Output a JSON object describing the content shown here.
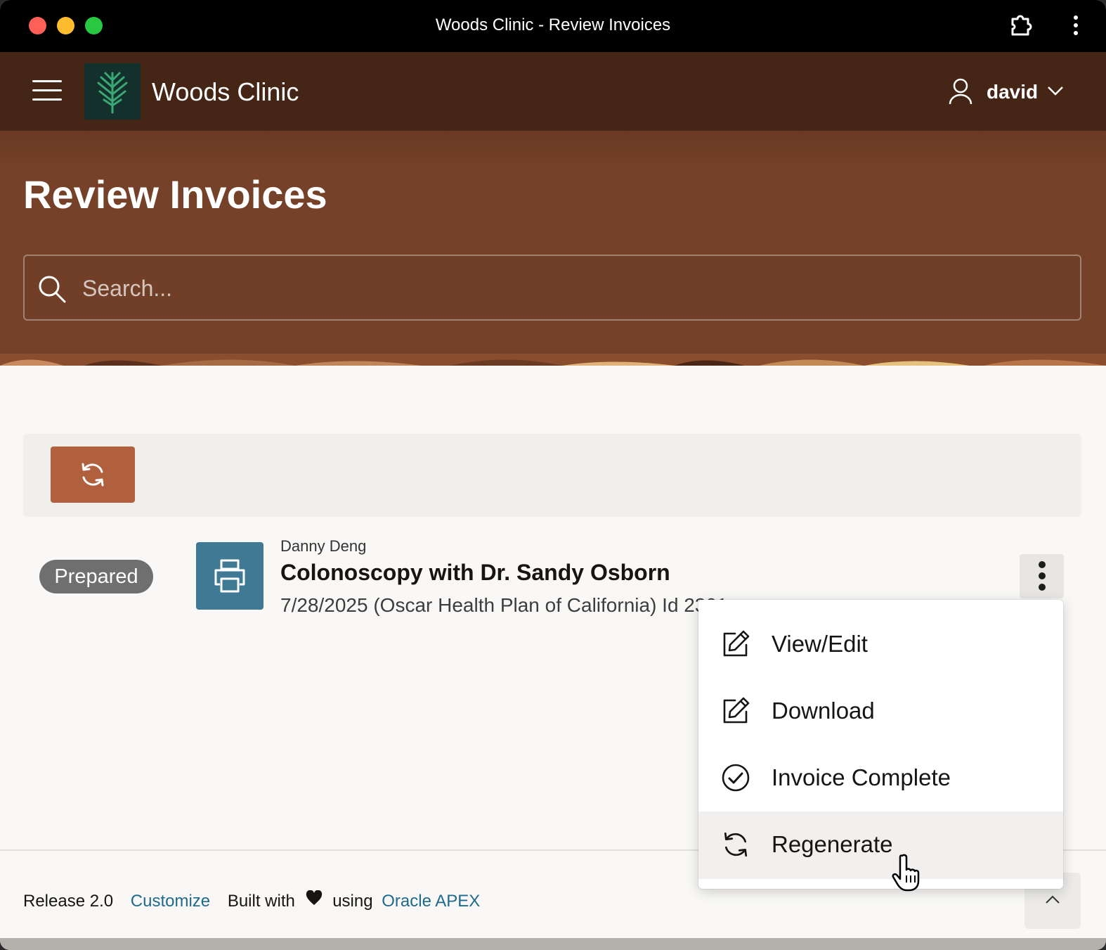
{
  "window": {
    "title": "Woods Clinic - Review Invoices"
  },
  "header": {
    "app_name": "Woods Clinic",
    "user": "david"
  },
  "page": {
    "title": "Review Invoices"
  },
  "search": {
    "placeholder": "Search..."
  },
  "invoice": {
    "status": "Prepared",
    "patient": "Danny Deng",
    "title": "Colonoscopy with Dr. Sandy Osborn",
    "detail": "7/28/2025 (Oscar Health Plan of California) Id 2301"
  },
  "menu": {
    "items": [
      {
        "label": "View/Edit",
        "icon": "edit-icon"
      },
      {
        "label": "Download",
        "icon": "edit-icon"
      },
      {
        "label": "Invoice Complete",
        "icon": "check-circle-icon"
      },
      {
        "label": "Regenerate",
        "icon": "refresh-icon"
      }
    ]
  },
  "footer": {
    "release": "Release 2.0",
    "customize": "Customize",
    "built_with": "Built with",
    "using": "using",
    "apex": "Oracle APEX"
  },
  "colors": {
    "appbar": "#442516",
    "hero": "#764129",
    "accent_button": "#b0603c",
    "print_tile": "#3f7994",
    "link": "#1f6a8d"
  }
}
